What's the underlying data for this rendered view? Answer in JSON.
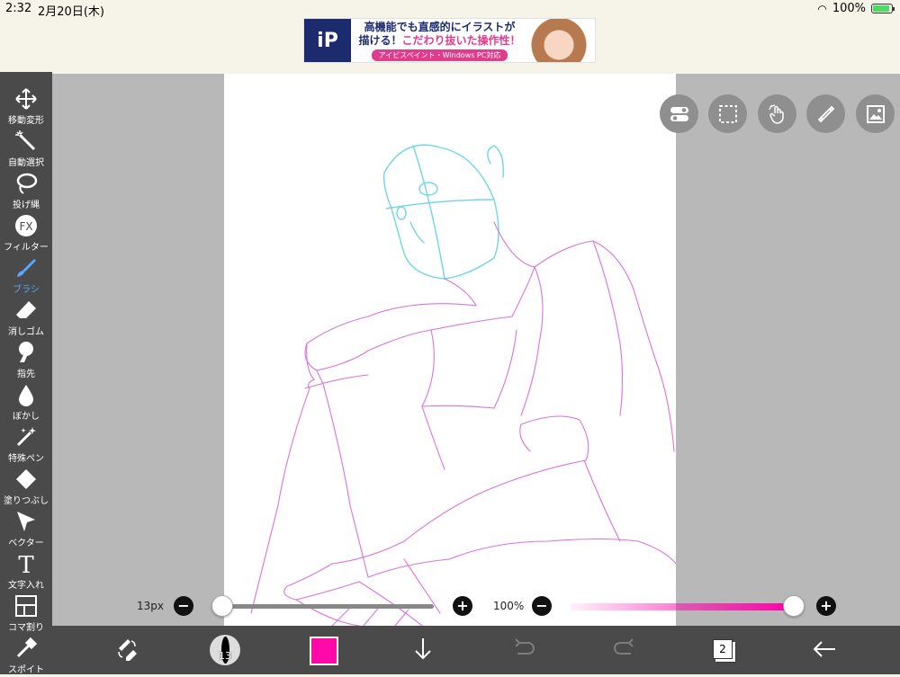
{
  "status": {
    "time": "2:32",
    "date": "2月20日(木)",
    "battery": "100%"
  },
  "ad": {
    "logo": "iP",
    "line1": "高機能でも直感的にイラストが",
    "line2_a": "描ける！",
    "line2_b": "こだわり抜いた操作性！",
    "line3": "アイビスペイント・Windows PC対応"
  },
  "tools": [
    {
      "label": "移動変形",
      "icon": "move-icon"
    },
    {
      "label": "自動選択",
      "icon": "magic-wand-icon"
    },
    {
      "label": "投げ縄",
      "icon": "lasso-icon"
    },
    {
      "label": "フィルター",
      "icon": "fx-icon"
    },
    {
      "label": "ブラシ",
      "icon": "brush-icon"
    },
    {
      "label": "消しゴム",
      "icon": "eraser-icon"
    },
    {
      "label": "指先",
      "icon": "finger-icon"
    },
    {
      "label": "ぼかし",
      "icon": "blur-icon"
    },
    {
      "label": "特殊ペン",
      "icon": "special-pen-icon"
    },
    {
      "label": "塗りつぶし",
      "icon": "fill-icon"
    },
    {
      "label": "ベクター",
      "icon": "vector-icon"
    },
    {
      "label": "文字入れ",
      "icon": "text-icon"
    },
    {
      "label": "コマ割り",
      "icon": "frame-icon"
    },
    {
      "label": "スポイト",
      "icon": "eyedropper-icon"
    }
  ],
  "active_tool": "ブラシ",
  "sliders": {
    "size_label": "13px",
    "opacity_label": "100%",
    "size_fraction": 0.0,
    "opacity_fraction": 1.0,
    "minus": "−",
    "plus": "+"
  },
  "brush_size_badge": "13",
  "color": "#ff0aa8",
  "layer_count": "2"
}
